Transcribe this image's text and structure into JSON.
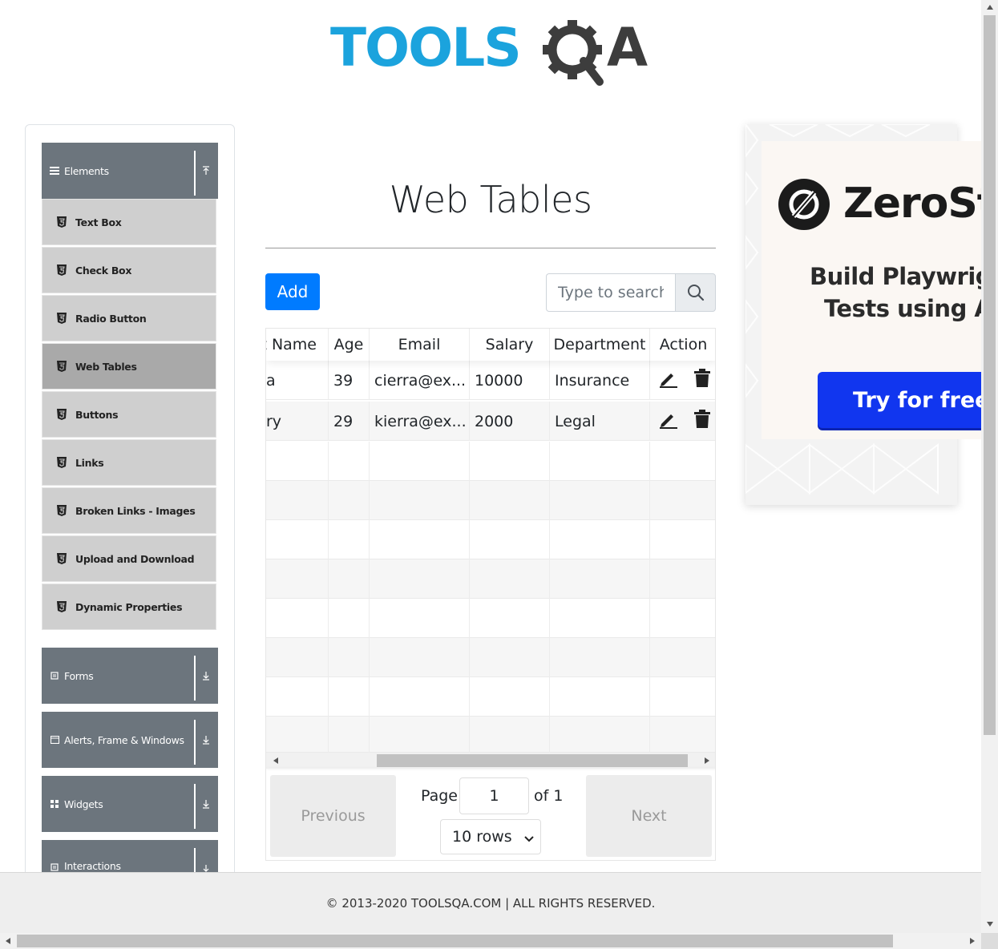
{
  "logo": {
    "text_left": "TOOLS",
    "text_right": "A",
    "color_blue": "#1ba3dd",
    "color_dark": "#3d3d3d"
  },
  "sidebar": {
    "groups": [
      {
        "label": "Elements",
        "icon": "hamburger-icon",
        "expanded": true
      },
      {
        "label": "Forms",
        "icon": "form-icon",
        "expanded": false
      },
      {
        "label": "Alerts, Frame & Windows",
        "icon": "window-icon",
        "expanded": false
      },
      {
        "label": "Widgets",
        "icon": "grid-icon",
        "expanded": false
      },
      {
        "label": "Interactions",
        "icon": "form-icon",
        "expanded": false
      }
    ],
    "items": [
      {
        "label": "Text Box"
      },
      {
        "label": "Check Box"
      },
      {
        "label": "Radio Button"
      },
      {
        "label": "Web Tables",
        "active": true
      },
      {
        "label": "Buttons"
      },
      {
        "label": "Links"
      },
      {
        "label": "Broken Links - Images"
      },
      {
        "label": "Upload and Download"
      },
      {
        "label": "Dynamic Properties"
      }
    ]
  },
  "main": {
    "title": "Web Tables",
    "add_label": "Add",
    "search_placeholder": "Type to search",
    "table": {
      "headers": [
        "t Name",
        "Age",
        "Email",
        "Salary",
        "Department",
        "Action"
      ],
      "rows": [
        {
          "last_name": "a",
          "age": "39",
          "email": "cierra@ex...",
          "salary": "10000",
          "department": "Insurance"
        },
        {
          "last_name": "ry",
          "age": "29",
          "email": "kierra@ex...",
          "salary": "2000",
          "department": "Legal"
        }
      ],
      "empty_rows": 8
    },
    "pagination": {
      "previous": "Previous",
      "next": "Next",
      "page_label": "Page",
      "page_value": "1",
      "of_label": "of 1",
      "rows_option": "10 rows"
    }
  },
  "ad": {
    "brand": "ZeroSt",
    "line1": "Build Playwrig",
    "line2": "Tests using A",
    "cta": "Try for free →"
  },
  "footer": {
    "text": "© 2013-2020 TOOLSQA.COM | ALL RIGHTS RESERVED."
  },
  "colors": {
    "accent": "#007bff",
    "sidebar_header": "#6c757d",
    "sidebar_item": "#cfcfcf",
    "sidebar_active": "#a9a9a9",
    "ad_cta": "#1136ef"
  }
}
